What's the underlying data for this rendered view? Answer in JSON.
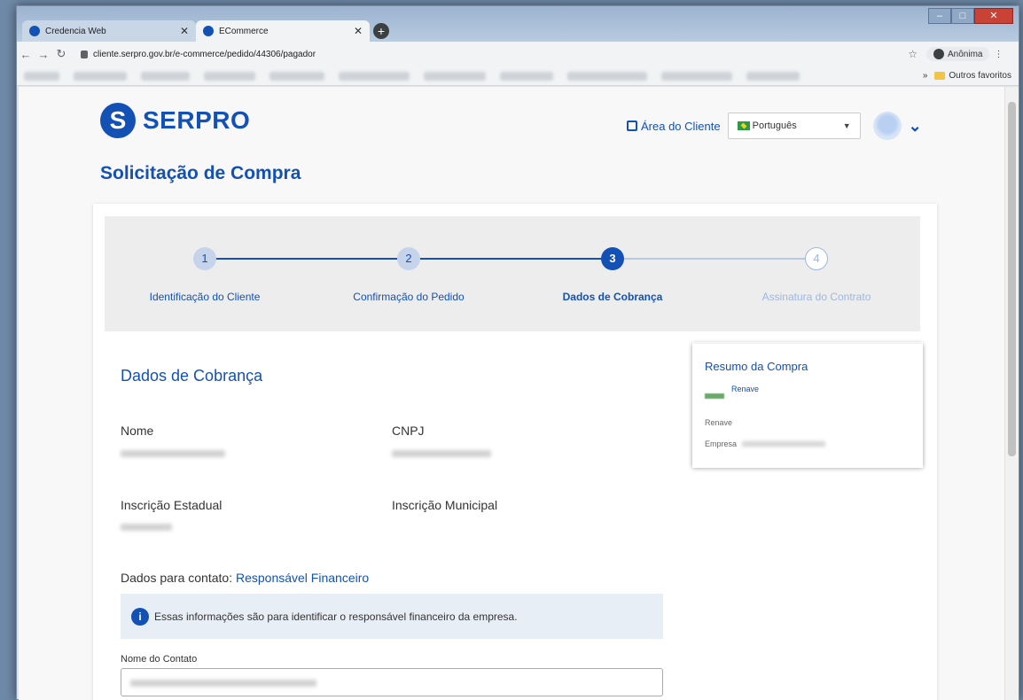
{
  "browser": {
    "tabs": [
      {
        "label": "Credencia Web"
      },
      {
        "label": "ECommerce"
      }
    ],
    "new_tab_label": "+",
    "url": "cliente.serpro.gov.br/e-commerce/pedido/44306/pagador",
    "incognito_label": "Anônima",
    "bookmarks_overflow": "»",
    "other_bookmarks": "Outros favoritos"
  },
  "header": {
    "logo_text": "SERPRO",
    "client_area_link": "Área do Cliente",
    "language_selected": "Português"
  },
  "page": {
    "title": "Solicitação de Compra"
  },
  "stepper": {
    "steps": [
      {
        "number": "1",
        "label": "Identificação do Cliente",
        "state": "done"
      },
      {
        "number": "2",
        "label": "Confirmação do Pedido",
        "state": "done"
      },
      {
        "number": "3",
        "label": "Dados de Cobrança",
        "state": "current"
      },
      {
        "number": "4",
        "label": "Assinatura do Contrato",
        "state": "future"
      }
    ]
  },
  "billing": {
    "section_title": "Dados de Cobrança",
    "name_label": "Nome",
    "cnpj_label": "CNPJ",
    "state_reg_label": "Inscrição Estadual",
    "municipal_reg_label": "Inscrição Municipal",
    "contact_prefix": "Dados para contato:",
    "contact_highlight": "Responsável Financeiro",
    "info_text": "Essas informações são para identificar o responsável financeiro da empresa.",
    "contact_name_label": "Nome do Contato"
  },
  "summary": {
    "title": "Resumo da Compra",
    "product_link": "Renave",
    "product_name": "Renave",
    "company_label": "Empresa"
  },
  "colors": {
    "primary": "#1351b4"
  }
}
